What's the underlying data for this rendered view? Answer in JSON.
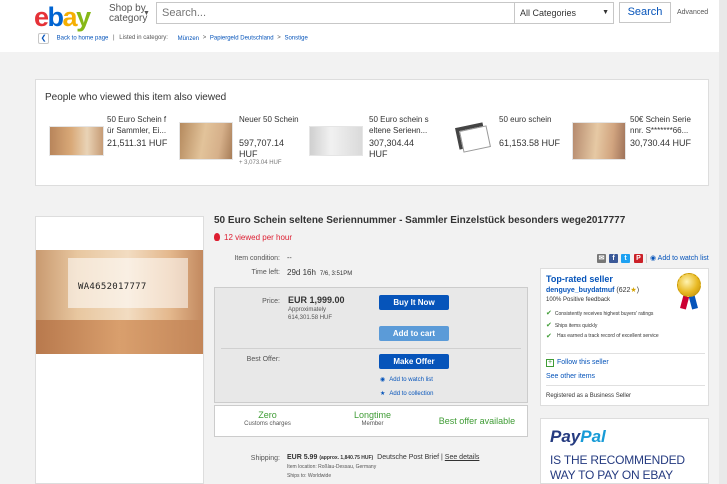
{
  "header": {
    "logo_letters": [
      "e",
      "b",
      "a",
      "y"
    ],
    "logo_colors": [
      "#e53238",
      "#0064d2",
      "#f5af02",
      "#86b817"
    ],
    "shop_by_line1": "Shop by",
    "shop_by_line2": "category",
    "search_placeholder": "Search...",
    "category_value": "All Categories",
    "search_button": "Search",
    "advanced_link": "Advanced"
  },
  "breadcrumb": {
    "back_label": "Back to home page",
    "separator": "|",
    "listed_in": "Listed in category:",
    "crumbs": [
      "Münzen",
      "Papiergeld Deutschland",
      "Sonstige"
    ]
  },
  "also_viewed": {
    "title": "People who viewed this item also viewed",
    "items": [
      {
        "title": "50 Euro Schein f ür Sammler, Ei...",
        "price": "21,511.31 HUF",
        "shipping": ""
      },
      {
        "title": "Neuer 50 Schein",
        "price": "597,707.14 HUF",
        "shipping": "+ 3,073.04 HUF"
      },
      {
        "title": "50 Euro schein s eltene Seriенn...",
        "price": "307,304.44 HUF",
        "shipping": ""
      },
      {
        "title": "50 euro schein",
        "price": "61,153.58 HUF",
        "shipping": ""
      },
      {
        "title": "50€ Schein Serie nnr. S*******66...",
        "price": "30,730.44 HUF",
        "shipping": ""
      }
    ]
  },
  "item": {
    "title": "50 Euro Schein seltene Seriennummer - Sammler Einzelstück besonders wege2017777",
    "viewed_per_hour": "12 viewed per hour",
    "serial_on_note": "WA4652017777",
    "condition_label": "Item condition:",
    "condition_value": "--",
    "time_left_label": "Time left:",
    "time_left_value": "29d 16h",
    "time_left_date": "7/6, 3:51PM",
    "price_label": "Price:",
    "price": "EUR 1,999.00",
    "approx_label": "Approximately",
    "approx_value": "614,301.58 HUF",
    "buy_it_now": "Buy It Now",
    "add_to_cart": "Add to cart",
    "best_offer_label": "Best Offer:",
    "make_offer": "Make Offer",
    "add_watch": "Add to watch list",
    "add_collection": "Add to collection",
    "badges": [
      {
        "title": "Zero",
        "sub": "Customs charges"
      },
      {
        "title": "Longtime",
        "sub": "Member"
      },
      {
        "title": "Best offer available",
        "sub": ""
      }
    ],
    "shipping_label": "Shipping:",
    "shipping_value": "EUR 5.99",
    "shipping_approx": "(approx. 1,840.75 HUF)",
    "shipping_service": "Deutsche Post Brief",
    "shipping_separator": "|",
    "see_details": "See details",
    "item_location": "Item location: Roßlau-Dessau, Germany",
    "ships_to": "Ships to: Worldwide"
  },
  "seller": {
    "share_watch": "Add to watch list",
    "top_rated": "Top-rated seller",
    "name": "denguye_buydatmuf",
    "feedback_score": "(622",
    "star": "★",
    "close_paren": ")",
    "positive": "100% Positive feedback",
    "features": [
      "Consistently receives highest buyers' ratings",
      "Ships items quickly",
      "Has earned a track record of excellent service"
    ],
    "follow": "Follow this seller",
    "see_other": "See other items",
    "business": "Registered as a Business Seller"
  },
  "paypal": {
    "logo_pay": "Pay",
    "logo_pal": "Pal",
    "line1": "IS THE RECOMMENDED",
    "line2": "WAY TO PAY ON EBAY"
  },
  "colors": {
    "accent": "#0654ba",
    "red": "#dd1e31",
    "green": "#3f9c35",
    "gold": "#e8b923"
  }
}
